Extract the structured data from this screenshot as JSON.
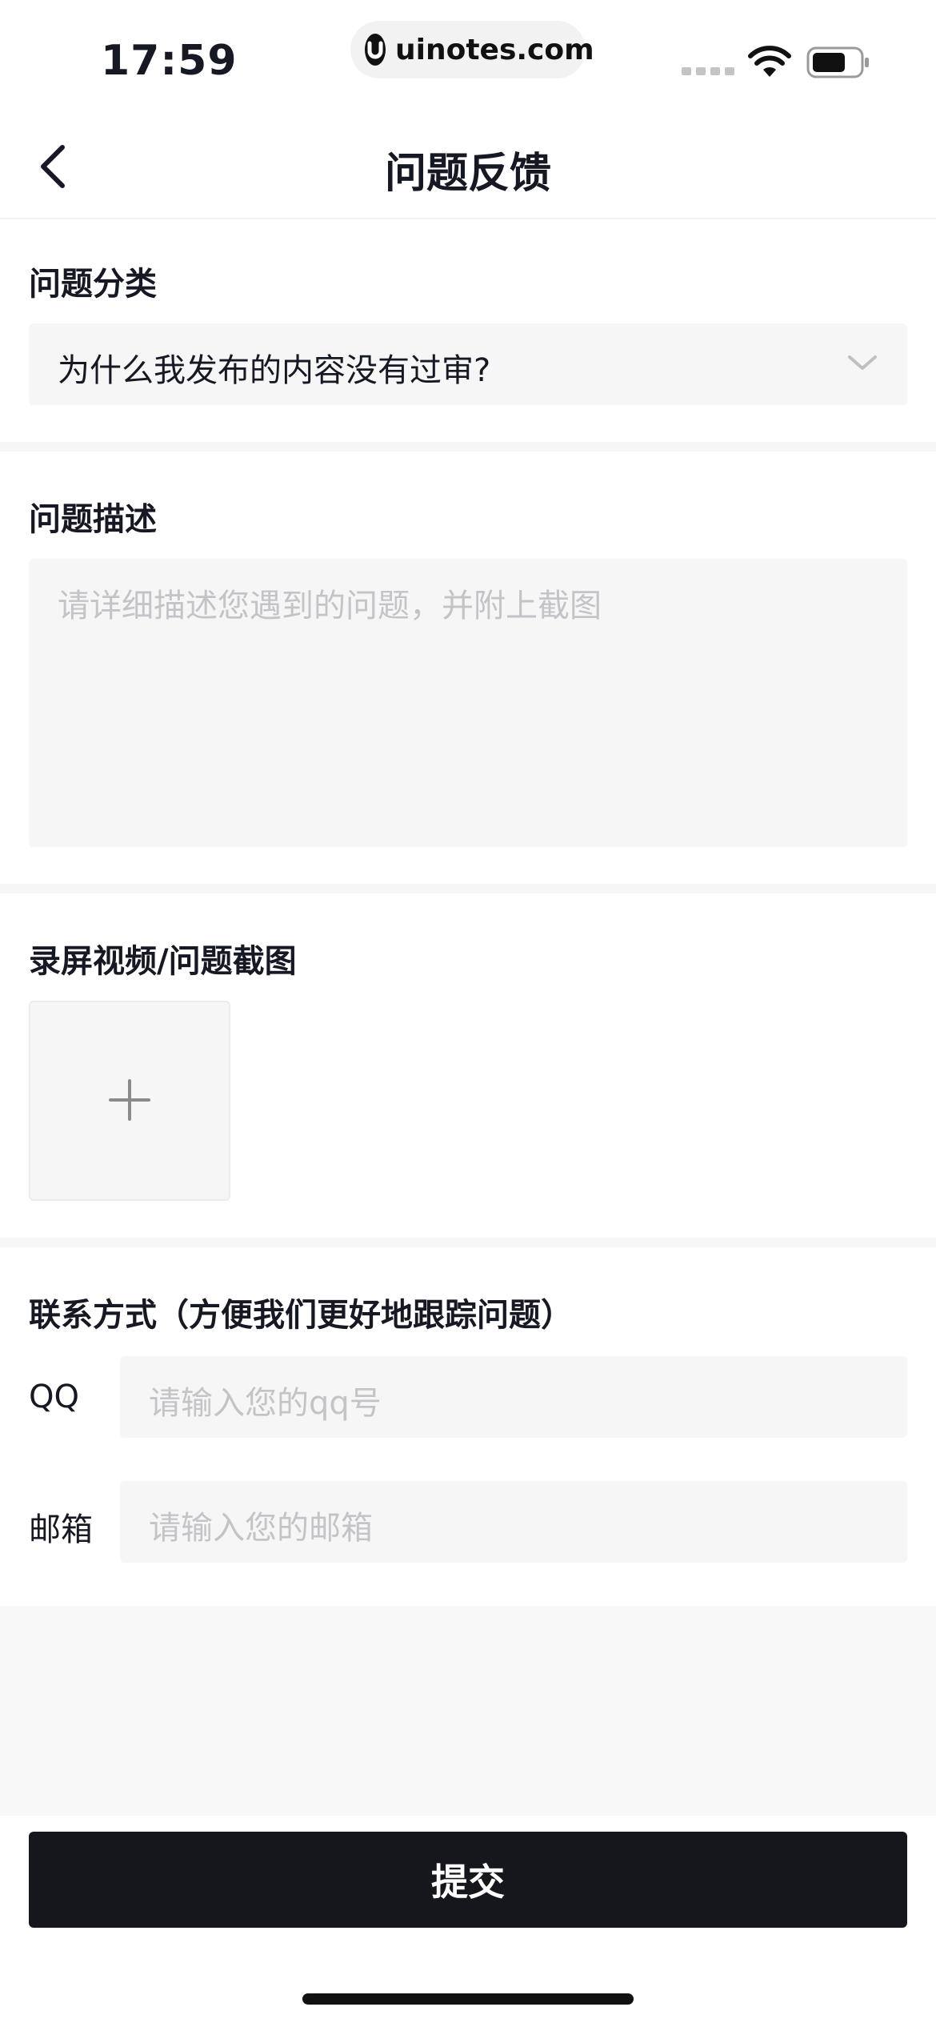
{
  "status_bar": {
    "time": "17:59",
    "url": "uinotes.com"
  },
  "nav": {
    "title": "问题反馈"
  },
  "category": {
    "label": "问题分类",
    "selected": "为什么我发布的内容没有过审?"
  },
  "description": {
    "label": "问题描述",
    "placeholder": "请详细描述您遇到的问题，并附上截图"
  },
  "media": {
    "label": "录屏视频/问题截图"
  },
  "contact": {
    "label": "联系方式（方便我们更好地跟踪问题）",
    "qq_label": "QQ",
    "qq_placeholder": "请输入您的qq号",
    "email_label": "邮箱",
    "email_placeholder": "请输入您的邮箱"
  },
  "submit": {
    "label": "提交"
  },
  "colors": {
    "primary_button": "#15171c",
    "field_background": "#f6f6f6",
    "placeholder": "#c4c4c8"
  }
}
